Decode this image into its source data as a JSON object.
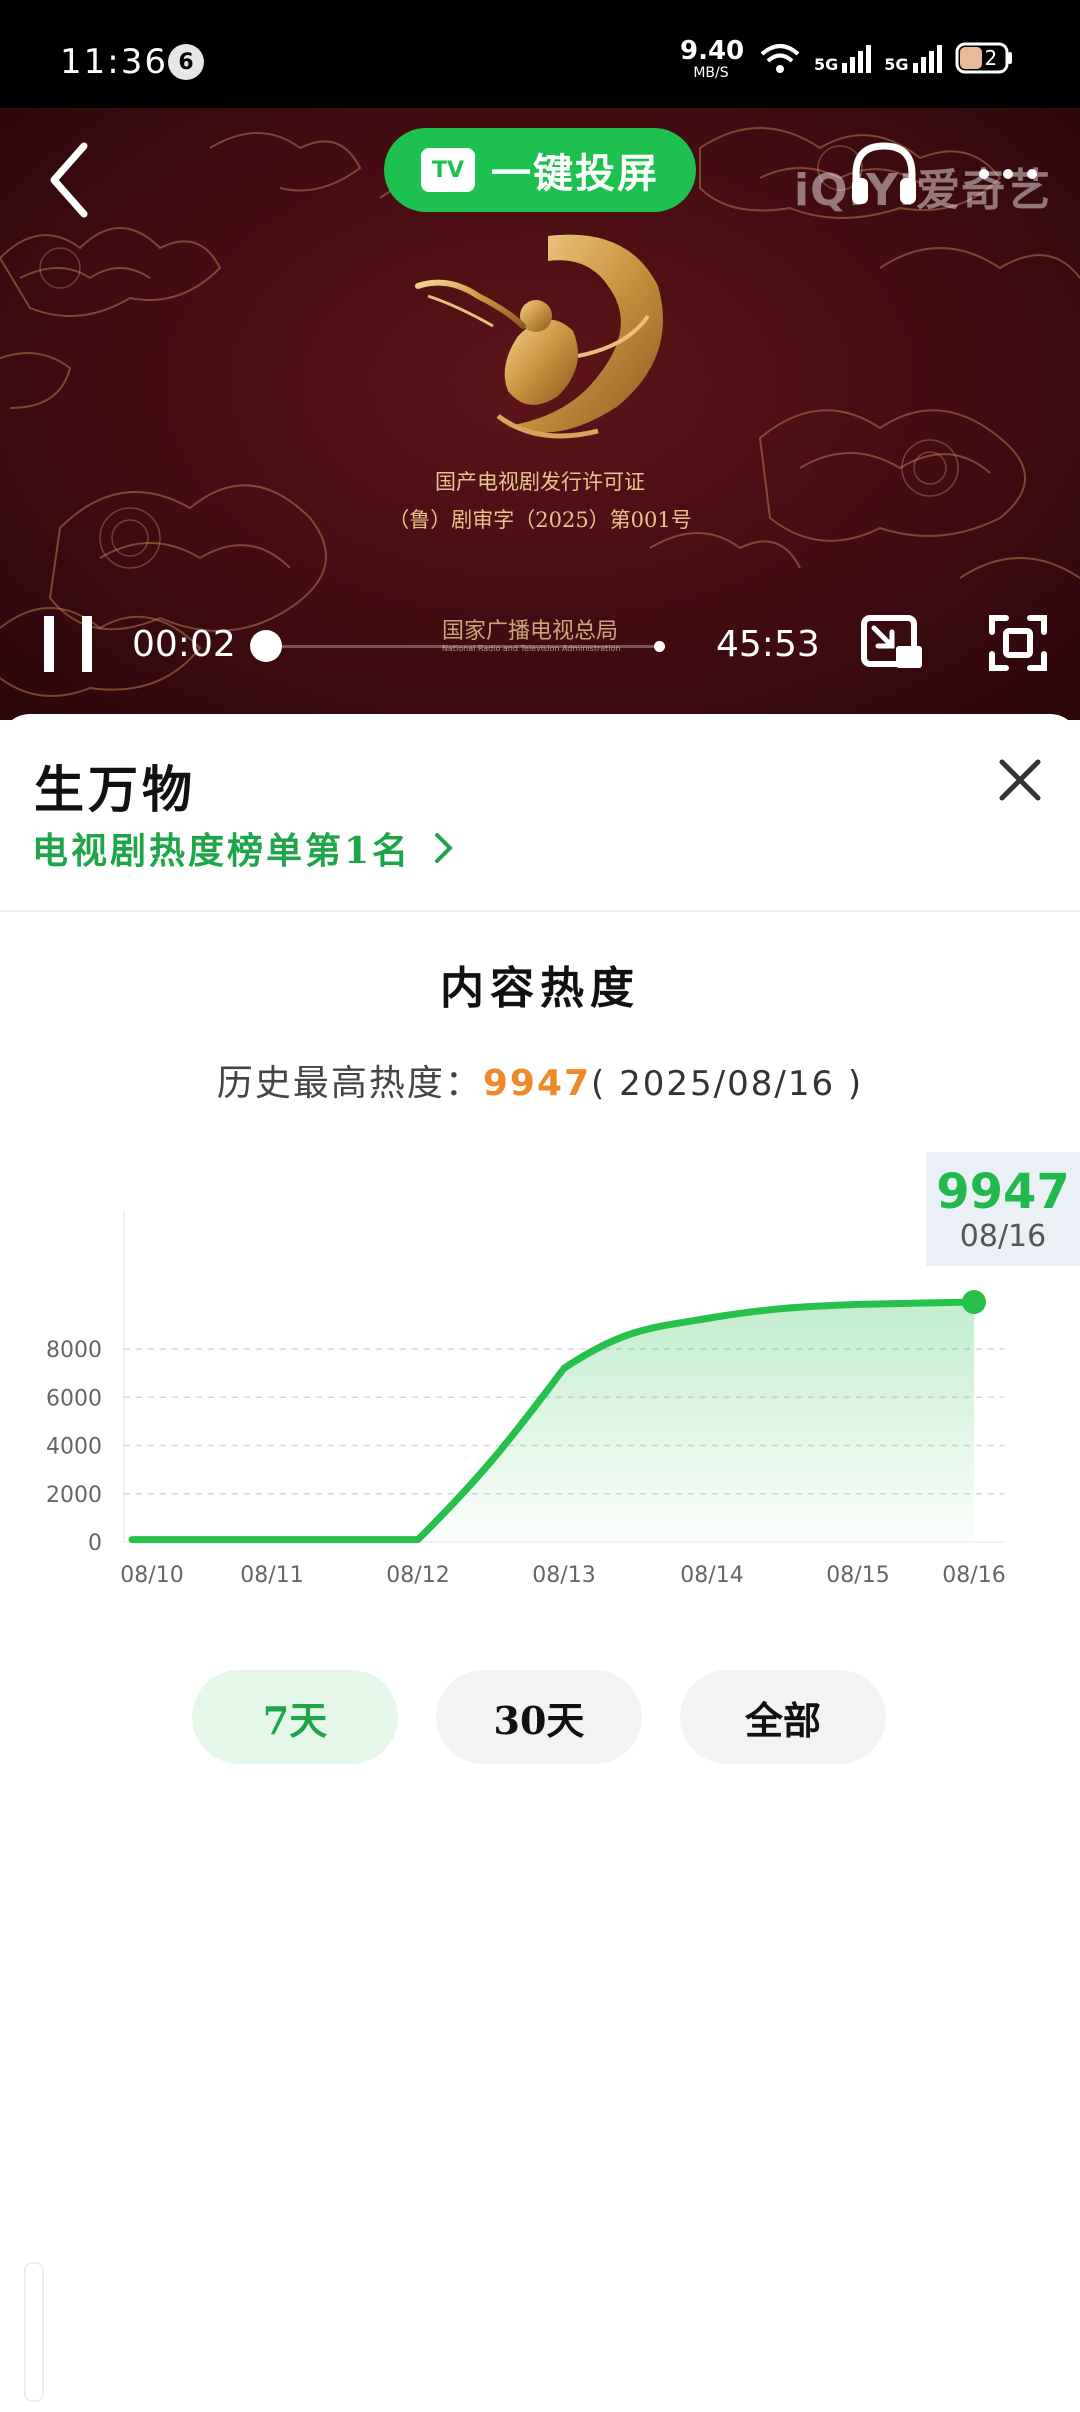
{
  "status_bar": {
    "time": "11:36",
    "notification_count": "6",
    "net_speed_value": "9.40",
    "net_speed_unit": "MB/S",
    "sim1_label": "5G",
    "sim2_label": "5G",
    "battery_level": "2"
  },
  "player": {
    "cast_label": "一键投屏",
    "cast_icon_text": "TV",
    "logo_text": "iQIYI爱奇艺",
    "license_line1": "国产电视剧发行许可证",
    "license_line2": "（鲁）剧审字（2025）第001号",
    "authority_cn": "国家广播电视总局",
    "authority_en": "National Radio and Television Administration",
    "current_time": "00:02",
    "total_time": "45:53",
    "progress_fraction": 0.0007
  },
  "sheet": {
    "title": "生万物",
    "rank_link": "电视剧热度榜单第1名",
    "section_title": "内容热度",
    "peak_prefix": "历史最高热度：",
    "peak_value": "9947",
    "peak_date": "( 2025/08/16 )",
    "tooltip_value": "9947",
    "tooltip_date": "08/16",
    "range_buttons": [
      "7天",
      "30天",
      "全部"
    ],
    "selected_range": "7天"
  },
  "colors": {
    "accent_green": "#1ec04f",
    "peak_orange": "#f0882c",
    "line_green": "#27c04c"
  },
  "chart_data": {
    "type": "area",
    "x": [
      "08/10",
      "08/11",
      "08/12",
      "08/13",
      "08/14",
      "08/15",
      "08/16"
    ],
    "series": [
      {
        "values": [
          100,
          100,
          100,
          7200,
          9300,
          9850,
          9947
        ]
      }
    ],
    "y_ticks": [
      0,
      2000,
      4000,
      6000,
      8000
    ],
    "ylim": [
      0,
      10000
    ],
    "grid": true,
    "highlight": {
      "x": "08/16",
      "value": 9947
    }
  }
}
